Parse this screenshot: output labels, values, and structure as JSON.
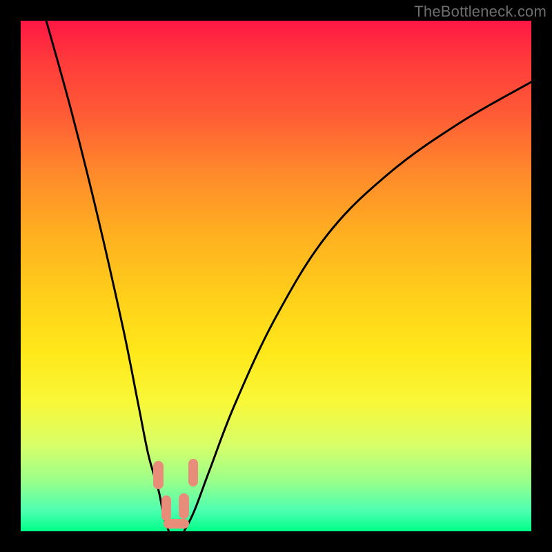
{
  "watermark": "TheBottleneck.com",
  "colors": {
    "page_bg": "#000000",
    "gradient_top": "#ff1744",
    "gradient_mid": "#ffd21a",
    "gradient_bottom": "#00ff88",
    "curve_stroke": "#000000",
    "marker_fill": "#e88d7a",
    "watermark_text": "#6e6e6e"
  },
  "chart_data": {
    "type": "line",
    "title": "",
    "xlabel": "",
    "ylabel": "",
    "xlim": [
      0,
      100
    ],
    "ylim": [
      0,
      100
    ],
    "series": [
      {
        "name": "left-descending-curve",
        "x": [
          5,
          10,
          15,
          20,
          23,
          25,
          27,
          28,
          29
        ],
        "values": [
          100,
          82,
          62,
          40,
          25,
          15,
          8,
          3,
          0
        ]
      },
      {
        "name": "right-ascending-curve",
        "x": [
          32,
          34,
          37,
          42,
          50,
          60,
          72,
          86,
          100
        ],
        "values": [
          0,
          4,
          12,
          25,
          42,
          58,
          70,
          80,
          88
        ]
      }
    ],
    "markers": [
      {
        "name": "left-upper-blob",
        "x": 27.0,
        "y": 11.0,
        "w": 2.0,
        "h": 5.5
      },
      {
        "name": "left-lower-blob",
        "x": 28.5,
        "y": 4.5,
        "w": 2.0,
        "h": 5.0
      },
      {
        "name": "right-lower-blob",
        "x": 32.0,
        "y": 5.0,
        "w": 2.0,
        "h": 5.0
      },
      {
        "name": "right-upper-blob",
        "x": 33.8,
        "y": 11.5,
        "w": 2.0,
        "h": 5.5
      },
      {
        "name": "bottom-blob",
        "x": 30.5,
        "y": 1.5,
        "w": 5.0,
        "h": 2.0
      }
    ]
  }
}
